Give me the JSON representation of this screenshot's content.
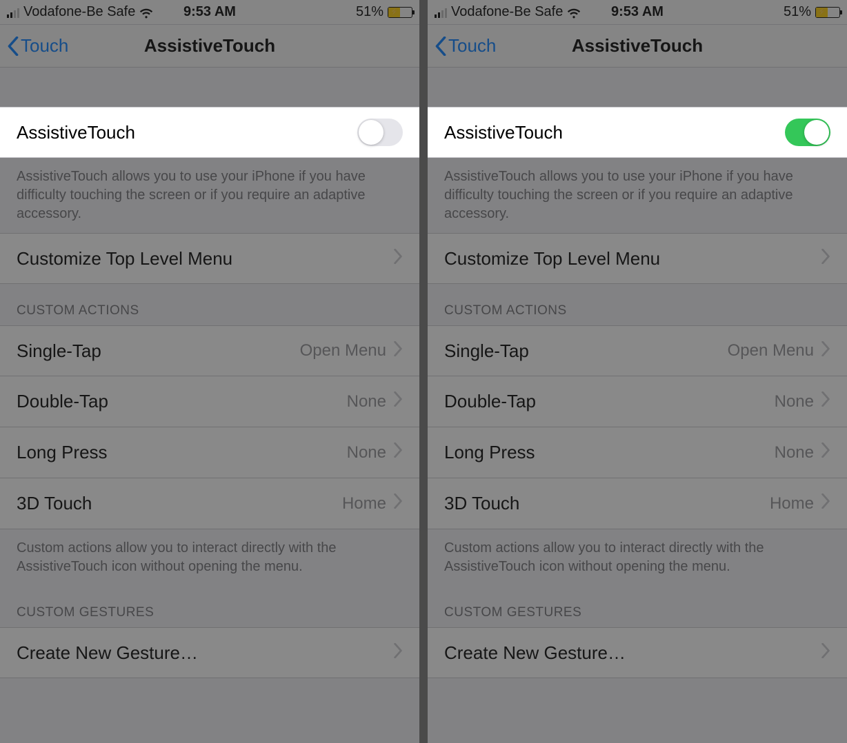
{
  "status": {
    "carrier": "Vodafone-Be Safe",
    "time": "9:53 AM",
    "battery_pct": "51%"
  },
  "nav": {
    "back_label": "Touch",
    "title": "AssistiveTouch"
  },
  "toggle_row": {
    "label": "AssistiveTouch"
  },
  "description": "AssistiveTouch allows you to use your iPhone if you have difficulty touching the screen or if you require an adaptive accessory.",
  "customize_row": "Customize Top Level Menu",
  "sections": {
    "custom_actions_header": "CUSTOM ACTIONS",
    "custom_actions_footer": "Custom actions allow you to interact directly with the AssistiveTouch icon without opening the menu.",
    "custom_gestures_header": "CUSTOM GESTURES"
  },
  "actions": {
    "single_tap": {
      "label": "Single-Tap",
      "value": "Open Menu"
    },
    "double_tap": {
      "label": "Double-Tap",
      "value": "None"
    },
    "long_press": {
      "label": "Long Press",
      "value": "None"
    },
    "three_d_touch": {
      "label": "3D Touch",
      "value": "Home"
    }
  },
  "gestures": {
    "create_new": "Create New Gesture…"
  },
  "colors": {
    "link": "#007aff",
    "toggle_on": "#34c759",
    "battery_fill": "#ffcc00"
  }
}
